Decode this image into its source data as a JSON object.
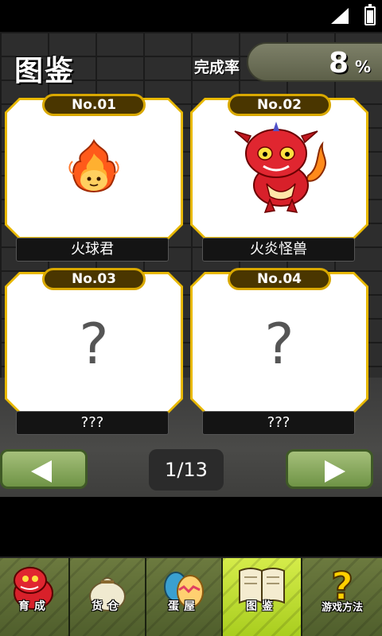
{
  "header": {
    "title": "图鉴",
    "rate_label": "完成率",
    "rate_value": "8",
    "rate_unit": "%"
  },
  "cards": [
    {
      "number": "No.01",
      "name": "火球君",
      "known": true,
      "creature": "fireball-creature"
    },
    {
      "number": "No.02",
      "name": "火炎怪兽",
      "known": true,
      "creature": "fire-dragon-creature"
    },
    {
      "number": "No.03",
      "name": "???",
      "known": false,
      "placeholder": "?"
    },
    {
      "number": "No.04",
      "name": "???",
      "known": false,
      "placeholder": "?"
    }
  ],
  "pagination": {
    "current": "1/13",
    "prev_icon": "left-arrow-icon",
    "next_icon": "right-arrow-icon"
  },
  "tabs": [
    {
      "label": "育成",
      "icon": "red-dragon-icon",
      "active": false
    },
    {
      "label": "货仓",
      "icon": "sack-icon",
      "active": false
    },
    {
      "label": "蛋屋",
      "icon": "egg-icon",
      "active": false
    },
    {
      "label": "图鉴",
      "icon": "book-icon",
      "active": true
    },
    {
      "label": "游戏方法",
      "icon": "question-icon",
      "active": false
    }
  ],
  "colors": {
    "card_border": "#e8b800",
    "active_tab": "#c2e038",
    "nav_button": "#8aad5c"
  }
}
